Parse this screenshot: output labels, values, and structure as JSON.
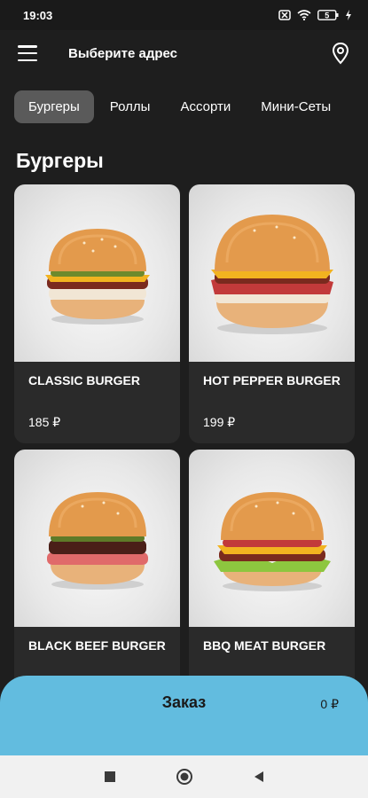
{
  "status_bar": {
    "time": "19:03",
    "battery": "5"
  },
  "header": {
    "address_label": "Выберите адрес"
  },
  "tabs": [
    {
      "label": "Бургеры",
      "active": true
    },
    {
      "label": "Роллы",
      "active": false
    },
    {
      "label": "Ассорти",
      "active": false
    },
    {
      "label": "Мини-Сеты",
      "active": false
    }
  ],
  "section": {
    "title": "Бургеры"
  },
  "products": [
    {
      "name": "CLASSIC BURGER",
      "price": "185 ₽"
    },
    {
      "name": "HOT PEPPER BURGER",
      "price": "199 ₽"
    },
    {
      "name": "BLACK BEEF BURGER",
      "price": ""
    },
    {
      "name": "BBQ MEAT BURGER",
      "price": ""
    }
  ],
  "order_bar": {
    "label": "Заказ",
    "total": "0 ₽"
  },
  "colors": {
    "background": "#1e1e1e",
    "card": "#2a2a2a",
    "accent": "#62bcdf",
    "active_tab": "#5a5a5a"
  },
  "icons": [
    "menu-icon",
    "location-pin-icon",
    "stop-square-icon",
    "home-circle-icon",
    "back-triangle-icon"
  ]
}
